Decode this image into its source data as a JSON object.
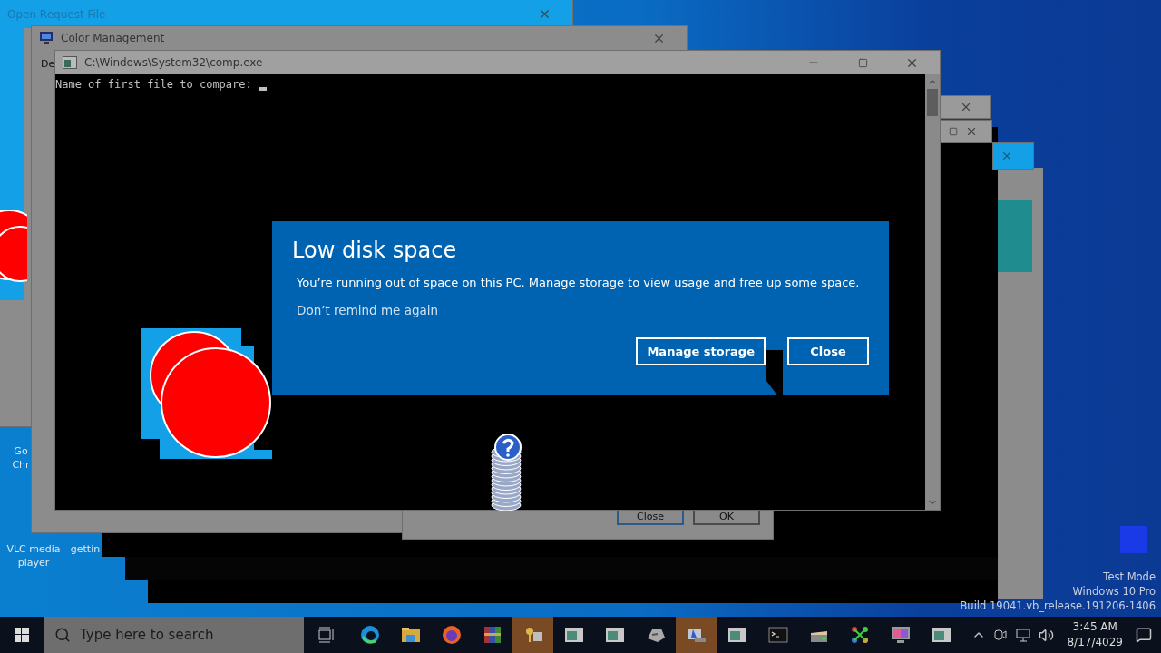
{
  "desktop_icons": [
    {
      "label": "Go Chr"
    },
    {
      "label": "VLC media player"
    },
    {
      "label": "gettin"
    }
  ],
  "windows": {
    "open_request_file": {
      "title": "Open Request File"
    },
    "color_management": {
      "title": "Color Management",
      "tab": "De"
    },
    "dialog": {
      "buttons": [
        {
          "label": "Close",
          "default": true
        },
        {
          "label": "OK",
          "default": false
        }
      ]
    },
    "console": {
      "title": "C:\\Windows\\System32\\comp.exe",
      "output": "Name of first file to compare:"
    }
  },
  "notification": {
    "title": "Low disk space",
    "message": "You’re running out of space on this PC. Manage storage to view usage and free up some space.",
    "link": "Don’t remind me again",
    "buttons": [
      {
        "label": "Manage storage"
      },
      {
        "label": "Close"
      }
    ]
  },
  "taskbar": {
    "search": {
      "placeholder": "Type here to search"
    },
    "apps": [
      {
        "kind": "edge",
        "selected": false
      },
      {
        "kind": "folder",
        "selected": false
      },
      {
        "kind": "firefox",
        "selected": false
      },
      {
        "kind": "archive",
        "selected": false
      },
      {
        "kind": "keys",
        "selected": true
      },
      {
        "kind": "window",
        "selected": false
      },
      {
        "kind": "window",
        "selected": false
      },
      {
        "kind": "disk",
        "selected": false
      },
      {
        "kind": "computer",
        "selected": true
      },
      {
        "kind": "window",
        "selected": false
      },
      {
        "kind": "console",
        "selected": false
      },
      {
        "kind": "scanner",
        "selected": false
      },
      {
        "kind": "network",
        "selected": false
      },
      {
        "kind": "monitor",
        "selected": false
      },
      {
        "kind": "window",
        "selected": false
      }
    ],
    "clock": {
      "time": "3:45 AM",
      "date": "8/17/4029"
    }
  },
  "system_watermark": [
    "Test Mode",
    "Windows 10 Pro",
    "Build 19041.vb_release.191206-1406"
  ]
}
